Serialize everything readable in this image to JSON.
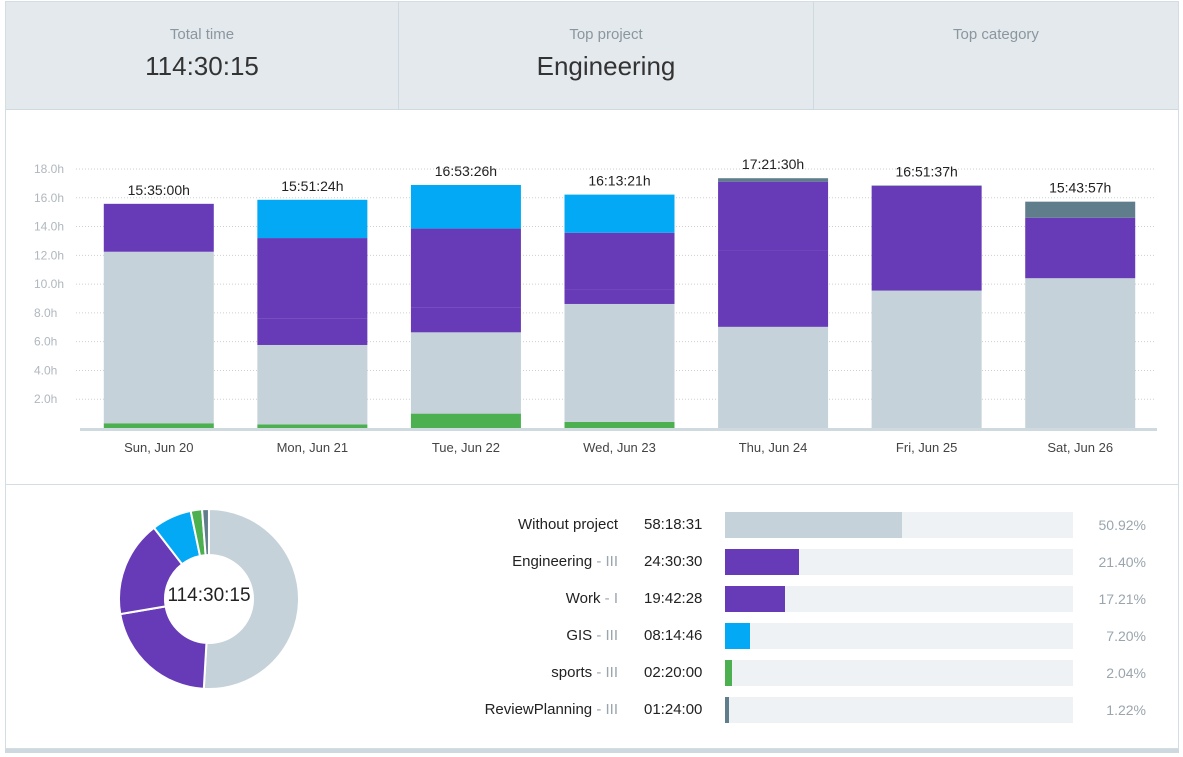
{
  "summary": {
    "total_time_label": "Total time",
    "total_time_value": "114:30:15",
    "top_project_label": "Top project",
    "top_project_value": "Engineering",
    "top_category_label": "Top category",
    "top_category_value": ""
  },
  "colors": {
    "without_project": "#c5d2da",
    "engineering": "#673ab7",
    "work": "#673ab7",
    "gis": "#03a9f4",
    "sports": "#4caf50",
    "review_planning": "#607d8b",
    "track": "#eef2f5",
    "grid": "#cfcfcf",
    "axis": "#cfd9e0"
  },
  "chart_data": {
    "type": "bar",
    "stacked": true,
    "y_unit": "h",
    "ylim": [
      0,
      18
    ],
    "yticks": [
      "2.0h",
      "4.0h",
      "6.0h",
      "8.0h",
      "10.0h",
      "12.0h",
      "14.0h",
      "16.0h",
      "18.0h"
    ],
    "grid": true,
    "categories": [
      "Sun, Jun 20",
      "Mon, Jun 21",
      "Tue, Jun 22",
      "Wed, Jun 23",
      "Thu, Jun 24",
      "Fri, Jun 25",
      "Sat, Jun 26"
    ],
    "totals": [
      "15:35:00h",
      "15:51:24h",
      "16:53:26h",
      "16:13:21h",
      "17:21:30h",
      "16:51:37h",
      "15:43:57h"
    ],
    "total_values": [
      15.58,
      15.86,
      16.89,
      16.22,
      17.36,
      16.86,
      15.73
    ],
    "series": [
      {
        "name": "sports",
        "color": "#4caf50",
        "values": [
          0.33,
          0.25,
          1.0,
          0.42,
          0.0,
          0.0,
          0.0
        ]
      },
      {
        "name": "Without project",
        "color": "#c5d2da",
        "values": [
          11.92,
          5.52,
          5.65,
          8.2,
          7.03,
          9.55,
          10.41
        ]
      },
      {
        "name": "Work",
        "color": "#673ab7",
        "values": [
          3.33,
          1.85,
          1.75,
          1.0,
          5.31,
          7.28,
          4.2
        ]
      },
      {
        "name": "Engineering",
        "color": "#673ab7",
        "values": [
          0.0,
          5.58,
          5.46,
          3.95,
          4.78,
          0.0,
          0.0
        ]
      },
      {
        "name": "GIS",
        "color": "#03a9f4",
        "values": [
          0.0,
          2.66,
          3.03,
          2.65,
          0.0,
          0.0,
          0.0
        ]
      },
      {
        "name": "ReviewPlanning",
        "color": "#607d8b",
        "values": [
          0.0,
          0.0,
          0.0,
          0.0,
          0.24,
          0.03,
          1.12
        ]
      }
    ]
  },
  "projects": [
    {
      "name": "Without project",
      "client": "",
      "duration": "58:18:31",
      "percent": "50.92%",
      "fraction": 0.5092,
      "color": "#c5d2da"
    },
    {
      "name": "Engineering",
      "client": " - III",
      "duration": "24:30:30",
      "percent": "21.40%",
      "fraction": 0.214,
      "color": "#673ab7"
    },
    {
      "name": "Work",
      "client": " - I",
      "duration": "19:42:28",
      "percent": "17.21%",
      "fraction": 0.1721,
      "color": "#673ab7"
    },
    {
      "name": "GIS",
      "client": " - III",
      "duration": "08:14:46",
      "percent": "7.20%",
      "fraction": 0.072,
      "color": "#03a9f4"
    },
    {
      "name": "sports",
      "client": " - III",
      "duration": "02:20:00",
      "percent": "2.04%",
      "fraction": 0.0204,
      "color": "#4caf50"
    },
    {
      "name": "ReviewPlanning",
      "client": " - III",
      "duration": "01:24:00",
      "percent": "1.22%",
      "fraction": 0.0122,
      "color": "#607d8b"
    }
  ],
  "donut": {
    "center_label": "114:30:15"
  }
}
